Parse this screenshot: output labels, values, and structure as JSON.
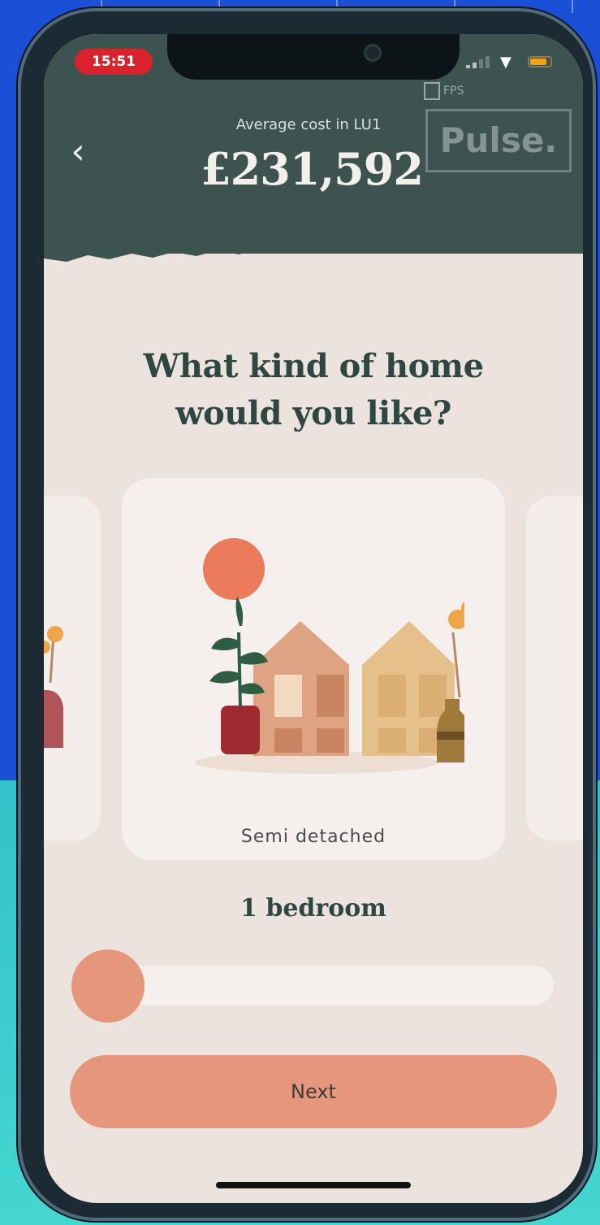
{
  "status_bar": {
    "time": "15:51"
  },
  "header": {
    "subtitle": "Average cost in LU1",
    "price": "£231,592",
    "fps_label": "FPS",
    "watermark": "Pulse."
  },
  "main": {
    "title_line1": "What kind of home",
    "title_line2": "would you like?",
    "selected_card": {
      "label": "Semi detached"
    },
    "bedrooms_label": "1 bedroom",
    "bedroom_slider": {
      "value_fraction": 0
    },
    "next_button": "Next"
  },
  "colors": {
    "header_bg": "#3d534f",
    "screen_bg": "#ece3de",
    "accent": "#e6967b",
    "title": "#2f4743"
  },
  "icons": [
    "back-icon",
    "signal-icon",
    "wifi-icon",
    "battery-icon"
  ]
}
